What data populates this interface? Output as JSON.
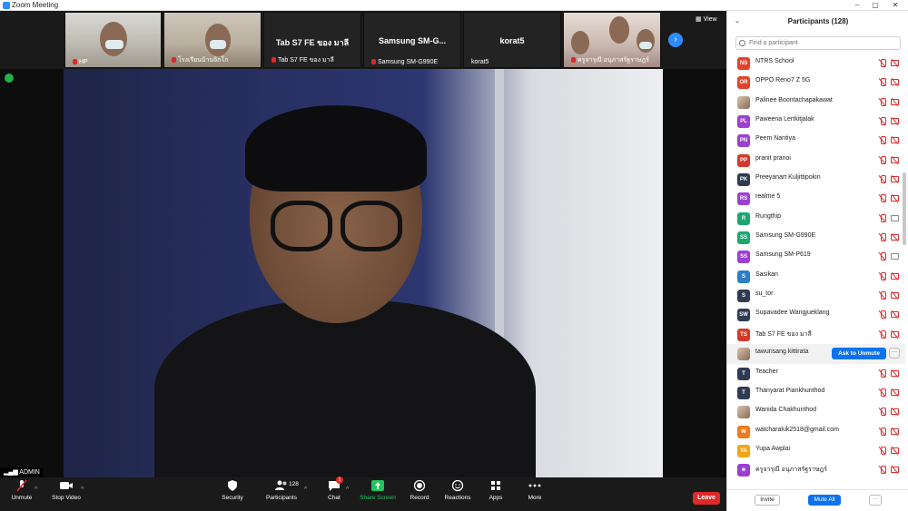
{
  "window": {
    "title": "Zoom Meeting",
    "controls": [
      "–",
      "▢",
      "✕"
    ]
  },
  "gallery": {
    "tiles": [
      {
        "name": "HP",
        "big": ""
      },
      {
        "name": "โรงเรียนบ้านจิกโก",
        "big": ""
      },
      {
        "name": "Tab S7 FE ของ มาลี",
        "big": "Tab S7 FE ของ มาลี"
      },
      {
        "name": "Samsung SM-G990E",
        "big": "Samsung  SM-G..."
      },
      {
        "name": "korat5",
        "big": "korat5"
      },
      {
        "name": "ครูจารุณี อนุภาสรัฐราษฎร์",
        "big": ""
      }
    ],
    "view_label": "View",
    "next_icon": "›"
  },
  "main_video": {
    "speaker_label": "ADMIN"
  },
  "toolbar": {
    "unmute": "Unmute",
    "stop_video": "Stop Video",
    "security": "Security",
    "participants": "Participants",
    "participants_count": "128",
    "chat": "Chat",
    "chat_badge": "1",
    "share_screen": "Share Screen",
    "record": "Record",
    "reactions": "Reactions",
    "apps": "Apps",
    "more": "More",
    "leave": "Leave"
  },
  "panel": {
    "title": "Participants (128)",
    "search_placeholder": "Find a participant",
    "invite": "Invite",
    "mute_all": "Mute All",
    "more_icon": "···",
    "ask_to_unmute": "Ask to Unmute",
    "participants": [
      {
        "initials": "NS",
        "name": "NTRS School",
        "color": "#e0442a",
        "video": "off"
      },
      {
        "initials": "OR",
        "name": "OPPO Reno7 Z 5G",
        "color": "#e0442a",
        "video": "off"
      },
      {
        "initials": "",
        "name": "Palinee Boontachapakawat",
        "color": "photo",
        "video": "off"
      },
      {
        "initials": "PL",
        "name": "Paweena Lertkitjalak",
        "color": "#9b3fd1",
        "video": "off"
      },
      {
        "initials": "PN",
        "name": "Peem Nantiya",
        "color": "#9b3fd1",
        "video": "off"
      },
      {
        "initials": "PP",
        "name": "pranit pranoi",
        "color": "#d33a2c",
        "video": "off"
      },
      {
        "initials": "PK",
        "name": "Preeyanart Kuljittipokin",
        "color": "#2f3b52",
        "video": "off"
      },
      {
        "initials": "RS",
        "name": "realme 5",
        "color": "#9b3fd1",
        "video": "off"
      },
      {
        "initials": "R",
        "name": "Rungthip",
        "color": "#1ea672",
        "video": "on"
      },
      {
        "initials": "SS",
        "name": "Samsung SM-G990E",
        "color": "#1ea672",
        "video": "off"
      },
      {
        "initials": "SS",
        "name": "Samsung SM-P619",
        "color": "#9b3fd1",
        "video": "on"
      },
      {
        "initials": "S",
        "name": "Sasikan",
        "color": "#2d7fc4",
        "video": "off"
      },
      {
        "initials": "S",
        "name": "su_tor",
        "color": "#2f3b52",
        "video": "off"
      },
      {
        "initials": "SW",
        "name": "Supavadee Wangjueklang",
        "color": "#2f3b52",
        "video": "off"
      },
      {
        "initials": "TS",
        "name": "Tab S7 FE ของ มาลี",
        "color": "#d33a2c",
        "video": "off"
      },
      {
        "initials": "",
        "name": "tawunsang kittirata",
        "color": "photo",
        "video": "ask"
      },
      {
        "initials": "T",
        "name": "Teacher",
        "color": "#2f3b52",
        "video": "off"
      },
      {
        "initials": "T",
        "name": "Thanyarat Piankhunthod",
        "color": "#2f3b52",
        "video": "off"
      },
      {
        "initials": "",
        "name": "Wanida Chakhunthod",
        "color": "photo",
        "video": "off"
      },
      {
        "initials": "W",
        "name": "watcharaluk2518@gmail.com",
        "color": "#ee7b1e",
        "video": "off"
      },
      {
        "initials": "YA",
        "name": "Yupa Awplai",
        "color": "#efa616",
        "video": "off"
      },
      {
        "initials": "ค",
        "name": "ครูจารุณี อนุภาสรัฐราษฎร์",
        "color": "#9b3fd1",
        "video": "off"
      }
    ]
  }
}
